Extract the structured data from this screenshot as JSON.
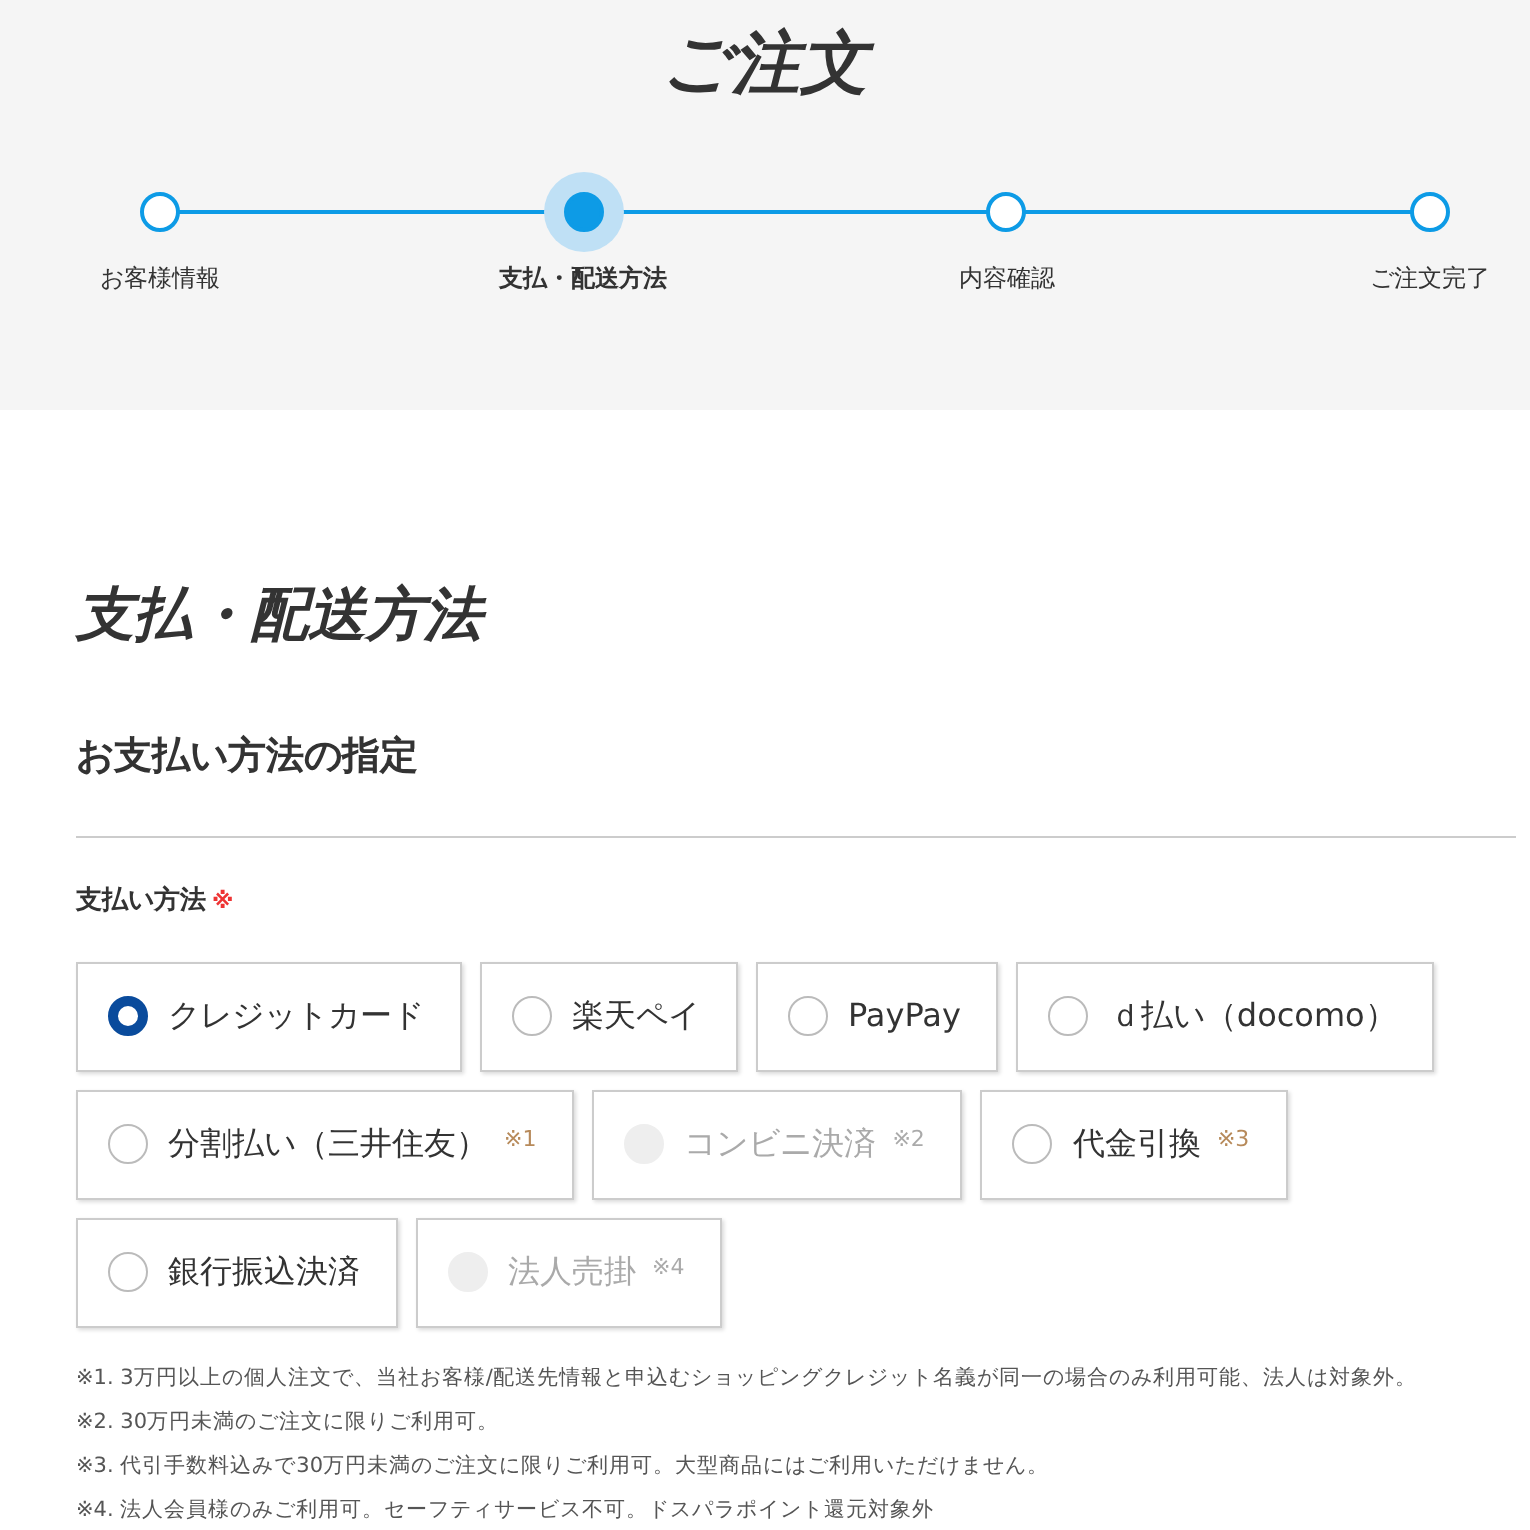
{
  "page_title": "ご注文",
  "steps": [
    {
      "label": "お客様情報",
      "selected": false
    },
    {
      "label": "支払・配送方法",
      "selected": true
    },
    {
      "label": "内容確認",
      "selected": false
    },
    {
      "label": "ご注文完了",
      "selected": false
    }
  ],
  "section_title": "支払・配送方法",
  "subsection_title": "お支払い方法の指定",
  "field_label": "支払い方法",
  "required_mark": "※",
  "options": [
    [
      {
        "label": "クレジットカード",
        "selected": true,
        "disabled": false
      },
      {
        "label": "楽天ペイ",
        "selected": false,
        "disabled": false
      },
      {
        "label": "PayPay",
        "selected": false,
        "disabled": false
      },
      {
        "label": "ｄ払い（docomo）",
        "selected": false,
        "disabled": false
      }
    ],
    [
      {
        "label": "分割払い（三井住友）",
        "note": "※1",
        "selected": false,
        "disabled": false
      },
      {
        "label": "コンビニ決済",
        "note": "※2",
        "selected": false,
        "disabled": true
      },
      {
        "label": "代金引換",
        "note": "※3",
        "selected": false,
        "disabled": false
      }
    ],
    [
      {
        "label": "銀行振込決済",
        "selected": false,
        "disabled": false
      },
      {
        "label": "法人売掛",
        "note": "※4",
        "selected": false,
        "disabled": true
      }
    ]
  ],
  "notes": [
    "※1. 3万円以上の個人注文で、当社お客様/配送先情報と申込むショッピングクレジット名義が同一の場合のみ利用可能、法人は対象外。",
    "※2. 30万円未満のご注文に限りご利用可。",
    "※3. 代引手数料込みで30万円未満のご注文に限りご利用可。大型商品にはご利用いただけません。",
    "※4. 法人会員様のみご利用可。セーフティサービス不可。ドスパラポイント還元対象外"
  ]
}
